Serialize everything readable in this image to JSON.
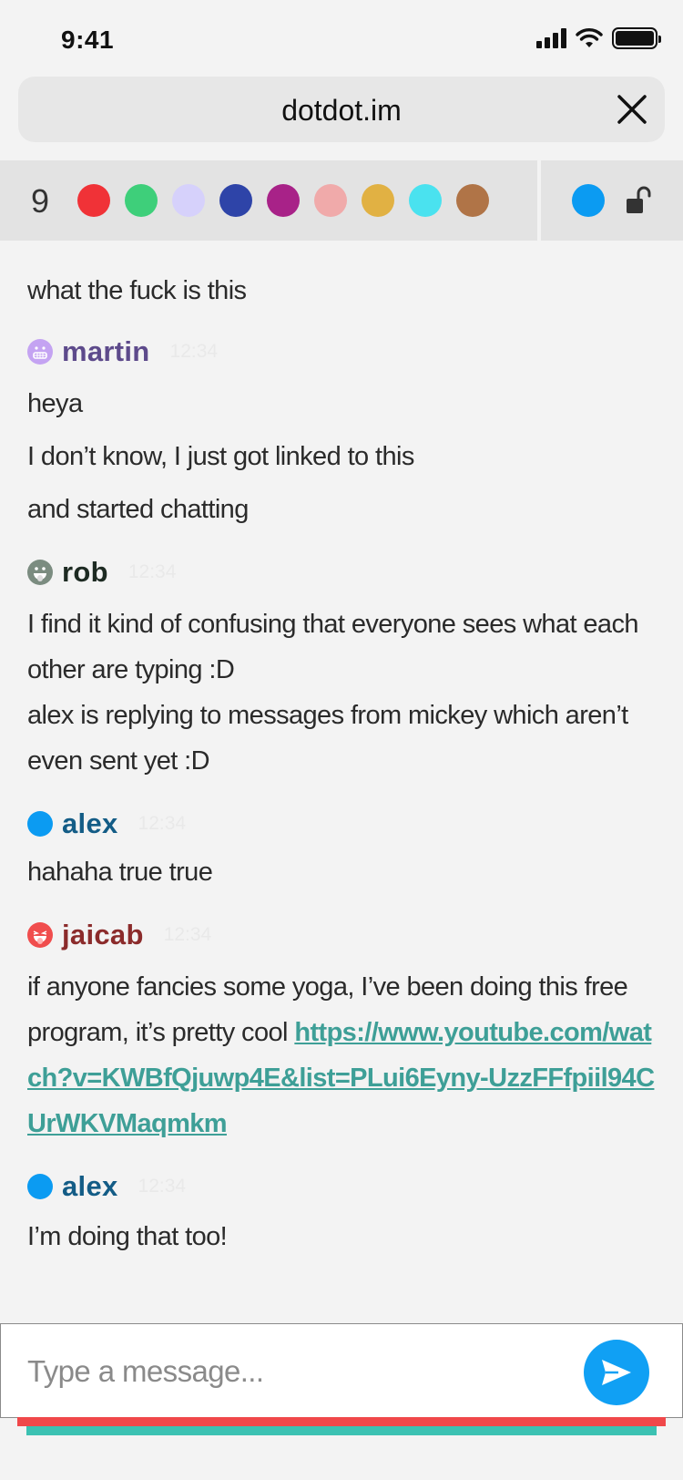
{
  "status_bar": {
    "time": "9:41"
  },
  "address_bar": {
    "url": "dotdot.im"
  },
  "users_bar": {
    "count": "9",
    "user_colors": [
      "#f03237",
      "#3ecf7a",
      "#d6d1fb",
      "#2e44a8",
      "#a82288",
      "#f0aaaa",
      "#e1b143",
      "#4ae2ef",
      "#b07447"
    ],
    "me_color": "#0b9bf2"
  },
  "messages": {
    "intro": {
      "text": "what the fuck is this"
    },
    "groups": [
      {
        "author": "martin",
        "time": "12:34",
        "color": "#5d4a8b",
        "avatar_color": "#c4a3f2",
        "lines": [
          "heya",
          "I don’t know, I just got linked to this",
          "and started chatting"
        ]
      },
      {
        "author": "rob",
        "time": "12:34",
        "color": "#1d2a22",
        "avatar_color": "#7b8c80",
        "lines": [
          "I find it kind of confusing that everyone sees what each other are typing :D",
          "alex is replying to messages from mickey which aren’t even sent yet :D"
        ]
      },
      {
        "author": "alex",
        "time": "12:34",
        "color": "#135c86",
        "avatar_color": "#0b9bf2",
        "lines": [
          "hahaha true true"
        ]
      },
      {
        "author": "jaicab",
        "time": "12:34",
        "color": "#8b2b2b",
        "avatar_color": "#f04d4d",
        "text": "if anyone fancies some yoga, I’ve been doing this free program, it’s pretty cool",
        "link": "https://www.youtube.com/watch?v=KWBfQjuwp4E&list=PLui6Eyny-UzzFFfpiil94CUrWKVMaqmkm"
      },
      {
        "author": "alex",
        "time": "12:34",
        "color": "#135c86",
        "avatar_color": "#0b9bf2",
        "lines": [
          "I’m doing that too!"
        ]
      }
    ]
  },
  "composer": {
    "placeholder": "Type a message..."
  },
  "icons": {
    "close": "close-icon",
    "lock": "unlocked-padlock-icon",
    "send": "send-icon"
  }
}
